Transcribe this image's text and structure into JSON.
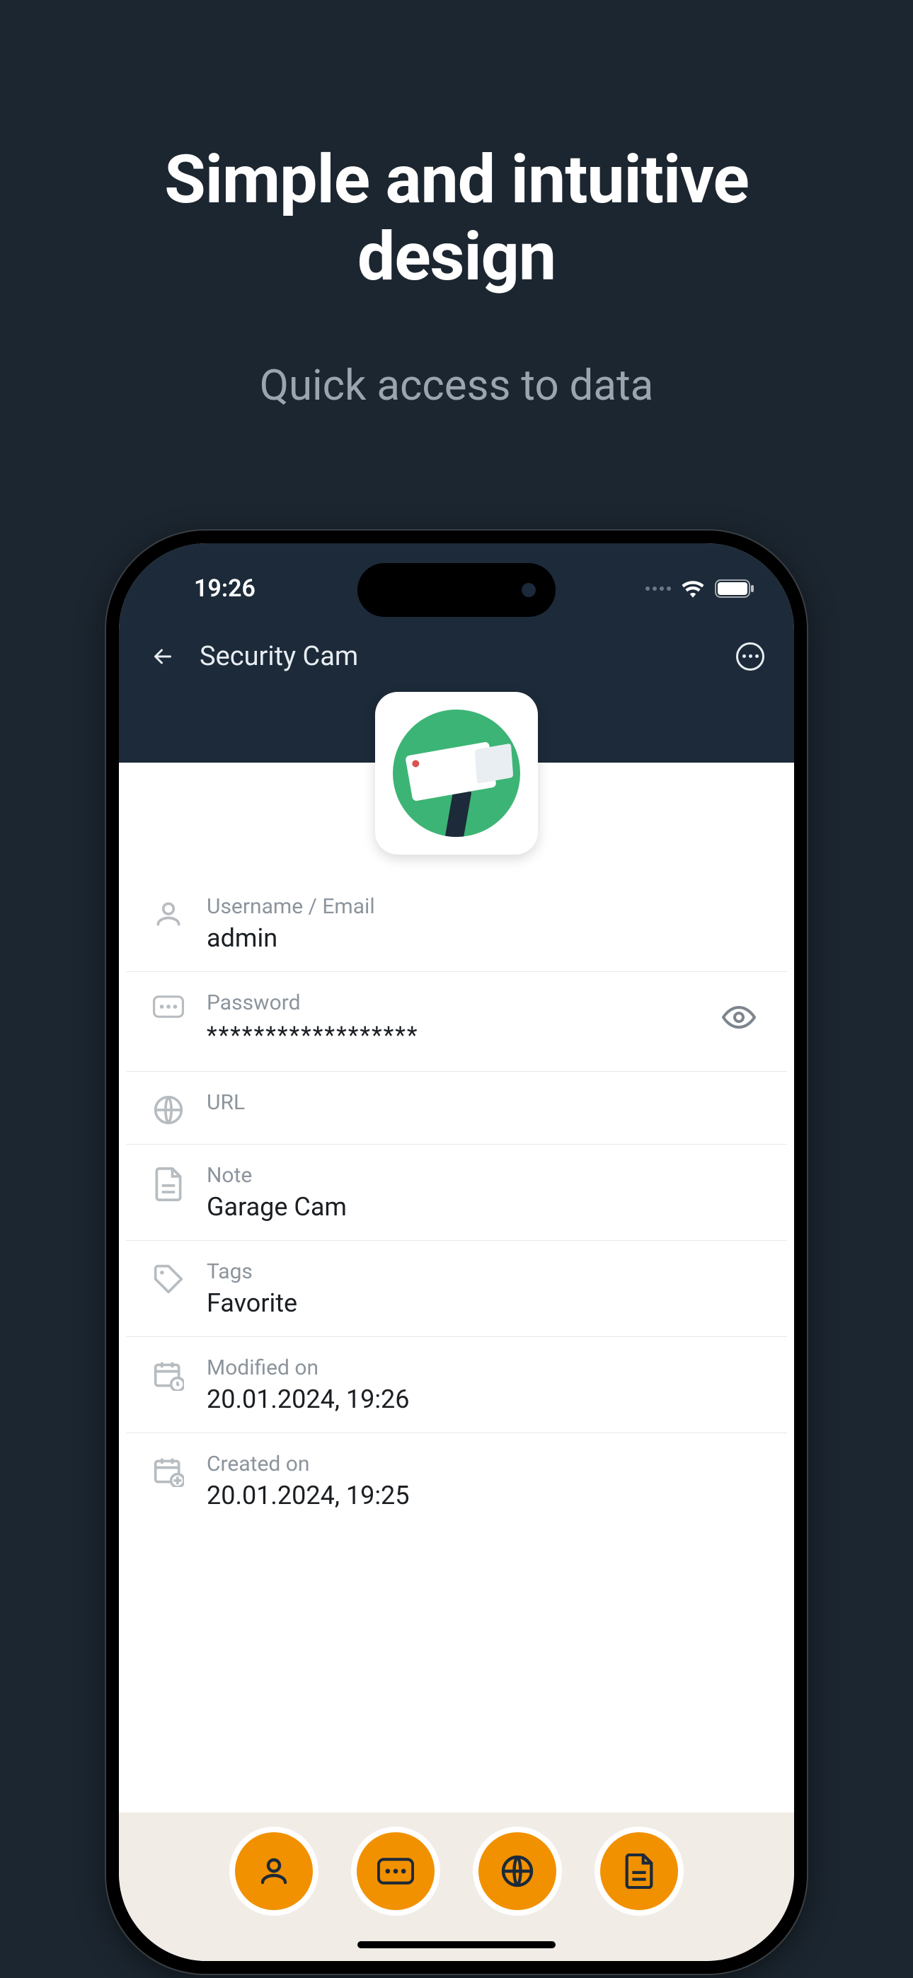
{
  "promo": {
    "title_line1": "Simple and intuitive",
    "title_line2": "design",
    "subtitle": "Quick access to data"
  },
  "status": {
    "time": "19:26"
  },
  "header": {
    "title": "Security Cam"
  },
  "fields": {
    "username": {
      "label": "Username / Email",
      "value": "admin"
    },
    "password": {
      "label": "Password",
      "value": "******************"
    },
    "url": {
      "label": "URL",
      "value": ""
    },
    "note": {
      "label": "Note",
      "value": "Garage Cam"
    },
    "tags": {
      "label": "Tags",
      "value": "Favorite"
    },
    "modified": {
      "label": "Modified on",
      "value": "20.01.2024, 19:26"
    },
    "created": {
      "label": "Created on",
      "value": "20.01.2024, 19:25"
    }
  },
  "colors": {
    "accent": "#f29100",
    "dark": "#1c2a39",
    "page_bg": "#1c2630"
  }
}
